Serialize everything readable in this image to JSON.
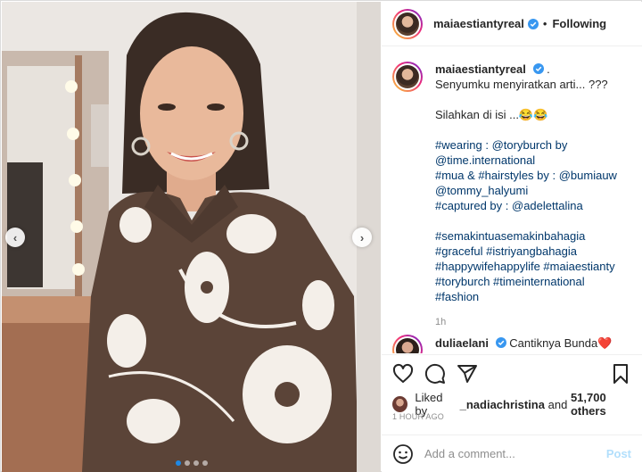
{
  "header": {
    "username": "maiaestiantyreal",
    "separator": "•",
    "follow_status": "Following"
  },
  "caption": {
    "username": "maiaestiantyreal",
    "after_badge": ".",
    "line1": "Senyumku menyiratkan arti... ???",
    "line2": "Silahkan di isi ...😂😂",
    "credits": [
      "#wearing : @toryburch by",
      "@time.international",
      "#mua & #hairstyles by : @bumiauw",
      "@tommy_halyumi",
      "#captured by : @adelettalina"
    ],
    "hashtags": [
      "#semakintuasemakinbahagia",
      "#graceful #istriyangbahagia",
      "#happywifehappylife #maiaestianty",
      "#toryburch #timeinternational",
      "#fashion"
    ],
    "time": "1h"
  },
  "comment": {
    "username": "duliaelani",
    "text": "Cantiknya Bunda❤️"
  },
  "actions": {
    "icons": [
      "heart-icon",
      "comment-icon",
      "share-icon",
      "bookmark-icon"
    ]
  },
  "likes": {
    "prefix": "Liked by",
    "user": "_nadiachristina",
    "middle": "and",
    "count": "51,700 others"
  },
  "post_time": "1 HOUR AGO",
  "add_comment": {
    "placeholder": "Add a comment...",
    "post_label": "Post"
  },
  "carousel": {
    "prev": "‹",
    "next": "›",
    "dots": 4,
    "active_dot": 1
  },
  "colors": {
    "verified": "#3897f0",
    "hashtag": "#00376b",
    "muted": "#8e8e8e",
    "post_disabled": "#b2dffc",
    "active_dot": "#1e88e5"
  }
}
